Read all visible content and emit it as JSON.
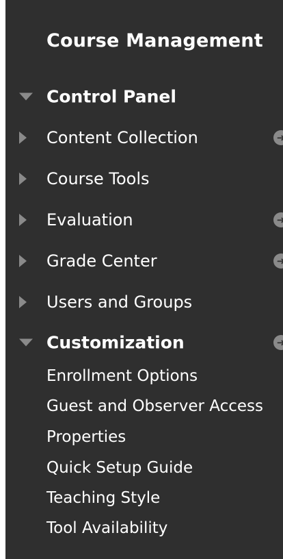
{
  "panel": {
    "title": "Course Management",
    "sections": [
      {
        "label": "Control Panel",
        "expanded": true
      },
      {
        "label": "Customization",
        "expanded": true
      }
    ],
    "control_panel_items": [
      {
        "label": "Content Collection"
      },
      {
        "label": "Course Tools"
      },
      {
        "label": "Evaluation"
      },
      {
        "label": "Grade Center"
      },
      {
        "label": "Users and Groups"
      }
    ],
    "customization_items": [
      {
        "label": "Enrollment Options"
      },
      {
        "label": "Guest and Observer Access"
      },
      {
        "label": "Properties"
      },
      {
        "label": "Quick Setup Guide"
      },
      {
        "label": "Teaching Style"
      },
      {
        "label": "Tool Availability"
      }
    ],
    "colors": {
      "background": "#2f2f2f",
      "text": "#ffffff",
      "arrow": "#8a8a8a"
    },
    "icons": {
      "collapsed": "triangle-right-icon",
      "expanded": "triangle-down-icon",
      "action": "circle-arrow-icon"
    }
  }
}
